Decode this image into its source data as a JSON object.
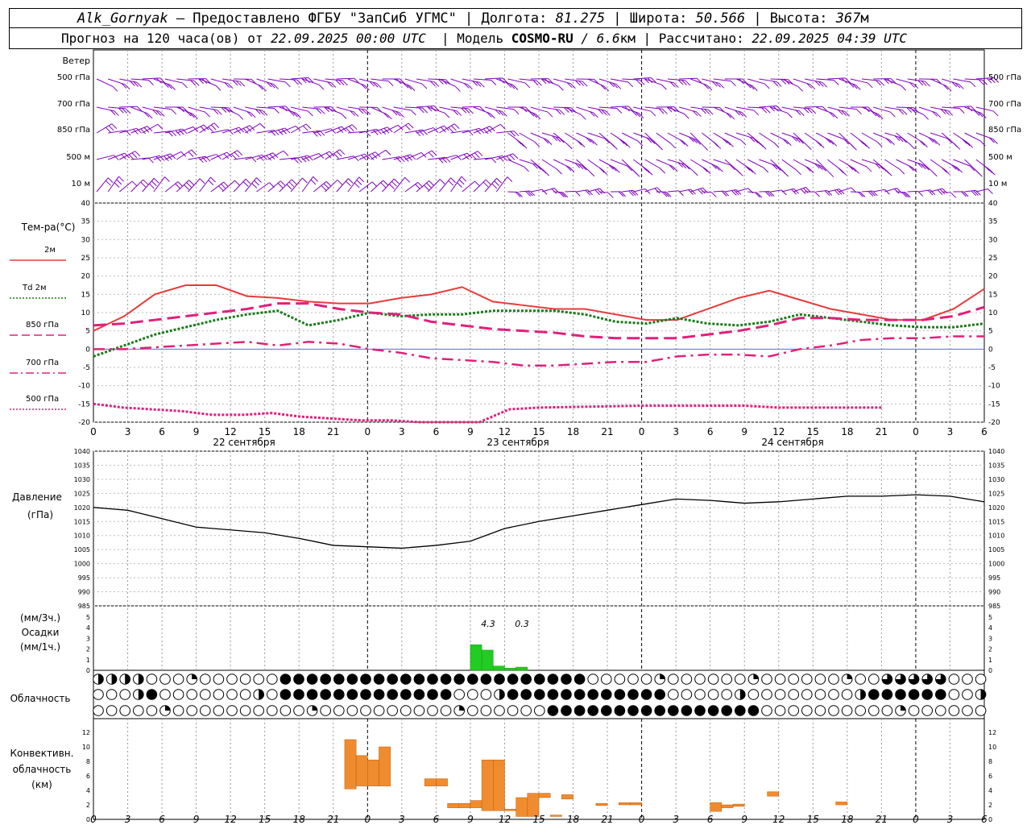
{
  "header": {
    "station": "Alk_Gornyak",
    "dash": " – Предоставлено ФГБУ \"ЗапСиб УГМС\" | Долгота: ",
    "lon": "81.275",
    "lat_label": " | Широта: ",
    "lat": "50.566",
    "alt_label": " | Высота: ",
    "alt": "367",
    "alt_unit": "м",
    "forecast_prefix": "Прогноз на 120 часа(ов) от ",
    "forecast_start": "22.09.2025 00:00 UTC",
    "model_prefix": "  | Модель ",
    "model": "COSMO-RU",
    "model_res": " / 6.6",
    "model_res_unit": "км",
    "calc_prefix": " | Рассчитано: ",
    "calc_time": "22.09.2025 04:39 UTC"
  },
  "wind_panel": {
    "title": "Ветер",
    "levels": [
      "500 гПа",
      "700 гПа",
      "850 гПа",
      "500 м",
      "10  м"
    ],
    "color": "#8000c0"
  },
  "temp_panel": {
    "title": "Тем-ра(°C)",
    "yticks": [
      40,
      35,
      30,
      25,
      20,
      15,
      10,
      5,
      0,
      -5,
      -10,
      -15,
      -20
    ],
    "legend": [
      {
        "label": "2м",
        "color": "#e83a3a",
        "style": "solid"
      },
      {
        "label": "Td  2м",
        "color": "#1a7a1a",
        "style": "dotted"
      },
      {
        "label": "850 гПа",
        "color": "#e0207a",
        "style": "dashed"
      },
      {
        "label": "700 гПа",
        "color": "#e0207a",
        "style": "dashdot"
      },
      {
        "label": "500 гПа",
        "color": "#e0207a",
        "style": "dotted"
      }
    ],
    "xticks": [
      "0",
      "3",
      "6",
      "9",
      "12",
      "15",
      "18",
      "21",
      "0",
      "3",
      "6",
      "9",
      "12",
      "15",
      "18",
      "21",
      "0",
      "3",
      "6",
      "9",
      "12",
      "15",
      "18",
      "21",
      "0",
      "3",
      "6"
    ],
    "days": [
      "22 сентября",
      "23 сентября",
      "24 сентября"
    ]
  },
  "pressure_panel": {
    "title": "Давление",
    "unit": "(гПа)",
    "yticks": [
      1040,
      1035,
      1030,
      1025,
      1020,
      1015,
      1010,
      1005,
      1000,
      995,
      990,
      985
    ]
  },
  "precip_panel": {
    "unit1": "(мм/3ч.)",
    "title": "Осадки",
    "unit2": "(мм/1ч.)",
    "yticks": [
      5,
      4,
      3,
      2,
      1,
      0
    ],
    "labels": [
      "4.3",
      "0.3"
    ]
  },
  "cloud_panel": {
    "title": "Облачность"
  },
  "conv_panel": {
    "title1": "Конвективн.",
    "title2": "облачность",
    "unit": "(км)",
    "yticks": [
      12,
      10,
      8,
      6,
      4,
      2,
      0
    ],
    "xticks": [
      "0",
      "3",
      "6",
      "9",
      "12",
      "15",
      "18",
      "21",
      "0",
      "3",
      "6",
      "9",
      "12",
      "15",
      "18",
      "21",
      "0",
      "3",
      "6",
      "9",
      "12",
      "15",
      "18",
      "21",
      "0",
      "3",
      "6"
    ]
  },
  "chart_data": [
    {
      "type": "line",
      "title": "Тем-ра(°C)",
      "x_hours": [
        0,
        3,
        6,
        9,
        12,
        15,
        18,
        21,
        24,
        27,
        30,
        33,
        36,
        39,
        42,
        45,
        48,
        51,
        54,
        57,
        60,
        63,
        66,
        69,
        72,
        75,
        78
      ],
      "ylim": [
        -20,
        40
      ],
      "series": [
        {
          "name": "2м",
          "values": [
            5,
            9,
            15,
            17.5,
            17.5,
            14.5,
            14,
            13,
            12.5,
            12.5,
            14,
            15,
            17,
            13,
            12,
            11,
            11,
            9.5,
            8,
            8,
            11,
            14,
            16,
            13.5,
            11,
            9.5,
            8,
            8,
            11,
            16.5
          ]
        },
        {
          "name": "Td 2м",
          "values": [
            -2,
            1,
            4,
            6,
            8,
            9.5,
            10.5,
            6.5,
            8,
            10,
            9,
            9.5,
            9.5,
            10.5,
            10.5,
            10.5,
            9.5,
            7.5,
            7,
            8.5,
            7,
            6.5,
            7.5,
            9.5,
            8.5,
            7.5,
            6.5,
            6,
            6,
            7
          ]
        },
        {
          "name": "850 гПа",
          "values": [
            6.5,
            7,
            8,
            9,
            10,
            11,
            12.5,
            12.5,
            11,
            10,
            9.5,
            7.5,
            6.5,
            5.5,
            5,
            4.5,
            3.5,
            3,
            3,
            3,
            4,
            5,
            6.5,
            8.5,
            8.5,
            8,
            8,
            8,
            9,
            11.5
          ]
        },
        {
          "name": "700 гПа",
          "values": [
            0,
            0,
            0.5,
            1,
            1.5,
            2,
            1,
            2,
            1.5,
            0,
            -1,
            -2.5,
            -3,
            -3.5,
            -4.5,
            -4.5,
            -4,
            -3.5,
            -3.5,
            -2,
            -1.5,
            -1.5,
            -2,
            0,
            1,
            2.5,
            3,
            3,
            3.5,
            3.5
          ]
        },
        {
          "name": "500 гПа",
          "values": [
            -15,
            -16,
            -16.5,
            -17,
            -18,
            -18,
            -17.5,
            -18.5,
            -19,
            -19.5,
            -19.5,
            -20,
            -20,
            -20,
            -16.5,
            -16,
            -15.5,
            -15.5,
            -15.5,
            -15.5,
            -16,
            -16,
            -16,
            -16
          ]
        }
      ]
    },
    {
      "type": "line",
      "title": "Давление",
      "x_hours": [
        0,
        3,
        6,
        9,
        12,
        15,
        18,
        21,
        24,
        27,
        30,
        33,
        36,
        39,
        42,
        45,
        48,
        51,
        54,
        57,
        60,
        63,
        66,
        69,
        72,
        75,
        78
      ],
      "ylim": [
        985,
        1040
      ],
      "series": [
        {
          "name": "",
          "values": [
            1020,
            1019,
            1016,
            1013,
            1012,
            1011,
            1009,
            1006.5,
            1006,
            1005.5,
            1006.5,
            1008,
            1012.5,
            1015,
            1017,
            1019,
            1021,
            1023,
            1022.5,
            1021.5,
            1022,
            1023,
            1024,
            1024,
            1024.5,
            1024,
            1022
          ]
        }
      ]
    },
    {
      "type": "bar",
      "title": "Осадки",
      "x_hours": [
        33,
        34,
        35,
        36,
        37
      ],
      "ylim": [
        0,
        5
      ],
      "series": [
        {
          "name": "",
          "values": [
            2.4,
            1.9,
            0.4,
            0.2,
            0.3
          ]
        }
      ],
      "annotations": [
        "4.3",
        "0.3"
      ]
    },
    {
      "type": "bar",
      "title": "Конвективн. облачность",
      "ylim": [
        0,
        12
      ],
      "bars": [
        {
          "x": 22,
          "base": 4.2,
          "top": 11
        },
        {
          "x": 23,
          "base": 4.6,
          "top": 8.8
        },
        {
          "x": 24,
          "base": 4.6,
          "top": 8.2
        },
        {
          "x": 25,
          "base": 4.6,
          "top": 10
        },
        {
          "x": 29,
          "base": 4.6,
          "top": 5.6
        },
        {
          "x": 30,
          "base": 4.6,
          "top": 5.6
        },
        {
          "x": 31,
          "base": 1.6,
          "top": 2.2
        },
        {
          "x": 32,
          "base": 1.6,
          "top": 2.2
        },
        {
          "x": 33,
          "base": 1.6,
          "top": 2.6
        },
        {
          "x": 34,
          "base": 1.2,
          "top": 8.2
        },
        {
          "x": 35,
          "base": 1.2,
          "top": 8.2
        },
        {
          "x": 36,
          "base": 1.2,
          "top": 1.4
        },
        {
          "x": 37,
          "base": 0.4,
          "top": 3
        },
        {
          "x": 38,
          "base": 0.4,
          "top": 3.6
        },
        {
          "x": 39,
          "base": 3,
          "top": 3.6
        },
        {
          "x": 40,
          "base": 0.4,
          "top": 0.6
        },
        {
          "x": 41,
          "base": 2.8,
          "top": 3.4
        },
        {
          "x": 44,
          "base": 1.9,
          "top": 2.2
        },
        {
          "x": 46,
          "base": 2.0,
          "top": 2.3
        },
        {
          "x": 47,
          "base": 2.0,
          "top": 2.3
        },
        {
          "x": 54,
          "base": 1.1,
          "top": 2.3
        },
        {
          "x": 55,
          "base": 1.6,
          "top": 2.0
        },
        {
          "x": 56,
          "base": 1.8,
          "top": 2.1
        },
        {
          "x": 59,
          "base": 3.2,
          "top": 3.8
        },
        {
          "x": 65,
          "base": 2.0,
          "top": 2.4
        }
      ]
    }
  ]
}
